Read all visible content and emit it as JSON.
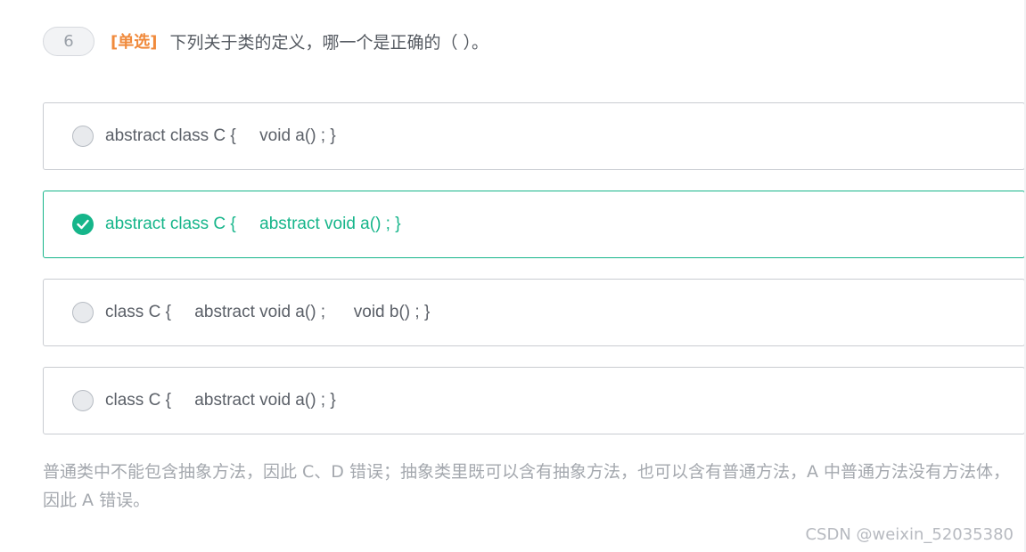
{
  "question": {
    "number": "6",
    "type_label": "[单选]",
    "text": "下列关于类的定义，哪一个是正确的（ ）。"
  },
  "options": [
    {
      "text": "abstract class C {     void a() ; }",
      "selected": false
    },
    {
      "text": "abstract class C {     abstract void a() ; }",
      "selected": true
    },
    {
      "text": "class C {     abstract void a() ;      void b() ; }",
      "selected": false
    },
    {
      "text": "class C {     abstract void a() ; }",
      "selected": false
    }
  ],
  "explanation": "普通类中不能包含抽象方法，因此 C、D 错误；抽象类里既可以含有抽象方法，也可以含有普通方法，A 中普通方法没有方法体，因此 A 错误。",
  "watermark": "CSDN @weixin_52035380",
  "colors": {
    "accent": "#16b58a",
    "type_label": "#f08a3c",
    "border": "#c9ccd1"
  },
  "icons": {
    "selected": "check-icon"
  }
}
